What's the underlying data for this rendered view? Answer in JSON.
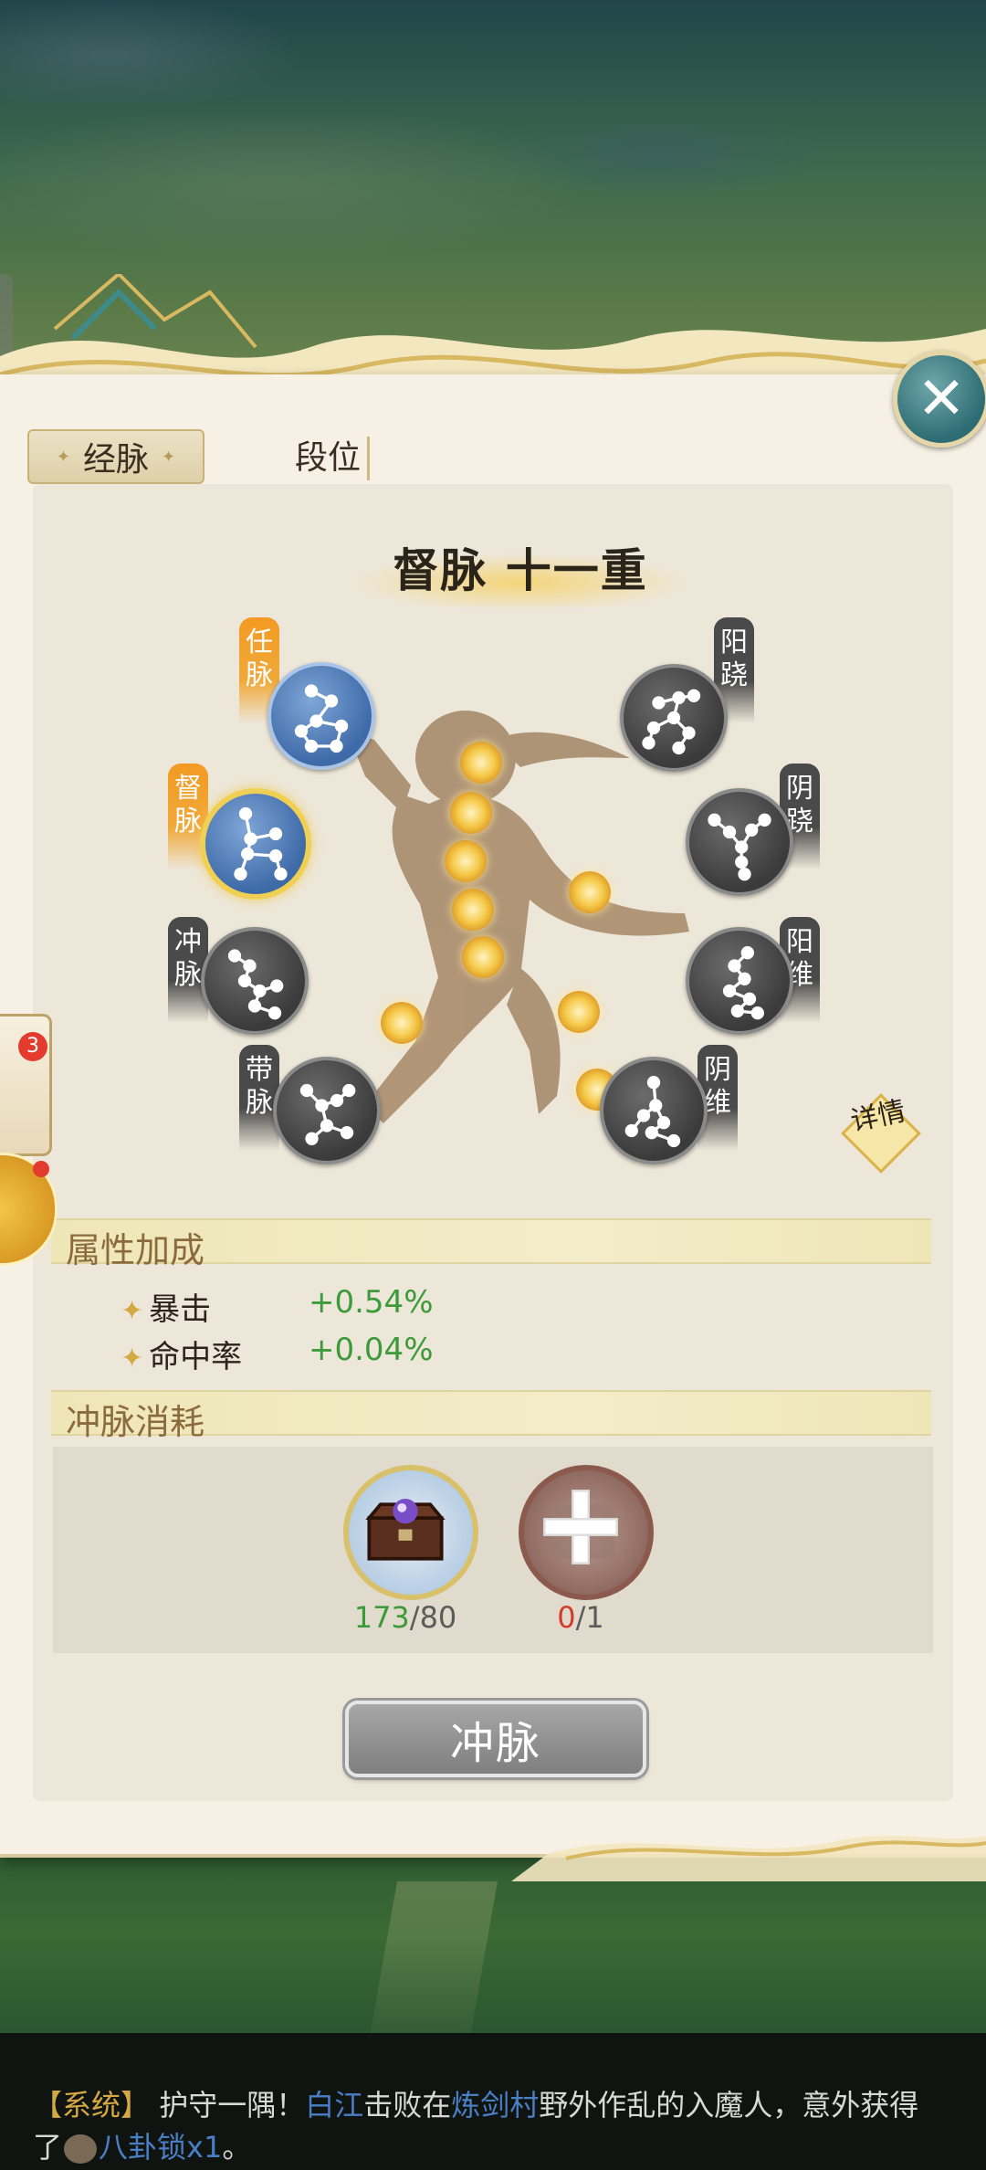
{
  "tabs": [
    {
      "label": "经脉",
      "active": true
    },
    {
      "label": "段位",
      "active": false
    }
  ],
  "title": "督脉 十一重",
  "meridians": [
    {
      "name": "任脉",
      "label_chars": "任脉",
      "state": "unlocked",
      "highlight": "orange"
    },
    {
      "name": "督脉",
      "label_chars": "督脉",
      "state": "current",
      "highlight": "orange"
    },
    {
      "name": "冲脉",
      "label_chars": "冲脉",
      "state": "locked"
    },
    {
      "name": "带脉",
      "label_chars": "带脉",
      "state": "locked"
    },
    {
      "name": "阳跷",
      "label_chars": "阳跷",
      "state": "locked"
    },
    {
      "name": "阴跷",
      "label_chars": "阴跷",
      "state": "locked"
    },
    {
      "name": "阳维",
      "label_chars": "阳维",
      "state": "locked"
    },
    {
      "name": "阴维",
      "label_chars": "阴维",
      "state": "locked"
    }
  ],
  "detail_label": "详情",
  "attributes": {
    "heading": "属性加成",
    "items": [
      {
        "name": "暴击",
        "value": "+0.54%"
      },
      {
        "name": "命中率",
        "value": "+0.04%"
      }
    ]
  },
  "cost": {
    "heading": "冲脉消耗",
    "items": [
      {
        "icon": "treasure-chest-icon",
        "have": "173",
        "need": "/80",
        "enough": true
      },
      {
        "icon": "add-item-icon",
        "have": "0",
        "need": "/1",
        "enough": false
      }
    ]
  },
  "action_button": "冲脉",
  "notification_count": "3",
  "chat": {
    "prefix": "【系统】",
    "line1_a": "护守一隅！",
    "player": "白江",
    "line1_b": "击败在",
    "location": "炼剑村",
    "line1_c": "野外作乱的入魔人，意外获得",
    "line2_a": "了",
    "item": "八卦锁x1",
    "line2_b": "。"
  },
  "colors": {
    "panel_bg": "#f6f1e4",
    "positive": "#3d9a3a",
    "insufficient": "#d23a2a",
    "accent_gold": "#d4a843",
    "close_teal": "#2d6c72"
  }
}
